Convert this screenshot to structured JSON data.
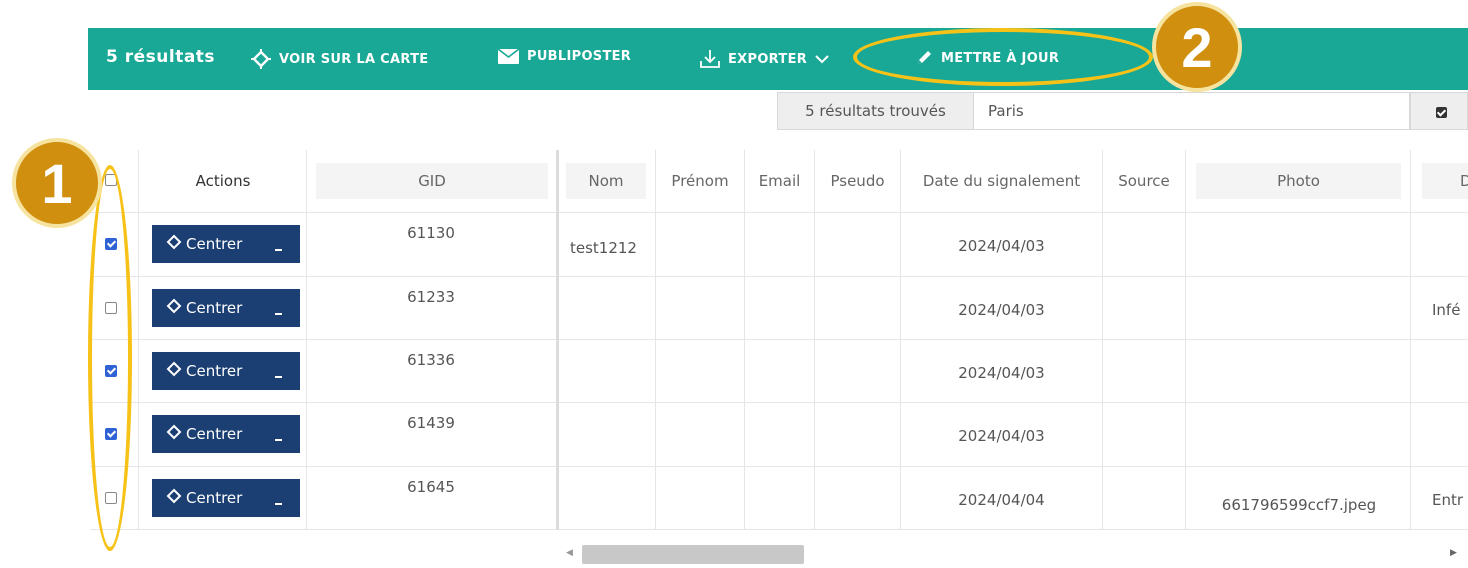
{
  "toolbar": {
    "results_count": "5 résultats",
    "view_map_label": "VOIR SUR LA CARTE",
    "mail_merge_label": "PUBLIPOSTER",
    "export_label": "EXPORTER",
    "update_label": "METTRE À JOUR",
    "background_color": "#19a896"
  },
  "search": {
    "found_label": "5 résultats trouvés",
    "value": "Paris"
  },
  "table": {
    "headers": {
      "actions": "Actions",
      "gid": "GID",
      "nom": "Nom",
      "prenom": "Prénom",
      "email": "Email",
      "pseudo": "Pseudo",
      "date": "Date du signalement",
      "source": "Source",
      "photo": "Photo",
      "next": "D"
    },
    "button_label": "Centrer",
    "rows": [
      {
        "checked": true,
        "gid": "61130",
        "nom": "test1212",
        "date": "2024/04/03",
        "photo": "",
        "next": ""
      },
      {
        "checked": false,
        "gid": "61233",
        "nom": "",
        "date": "2024/04/03",
        "photo": "",
        "next": "Infé"
      },
      {
        "checked": true,
        "gid": "61336",
        "nom": "",
        "date": "2024/04/03",
        "photo": "",
        "next": ""
      },
      {
        "checked": true,
        "gid": "61439",
        "nom": "",
        "date": "2024/04/03",
        "photo": "",
        "next": ""
      },
      {
        "checked": false,
        "gid": "61645",
        "nom": "",
        "date": "2024/04/04",
        "photo": "661796599ccf7.jpeg",
        "next": "Entr"
      }
    ]
  },
  "annotations": {
    "marker_1": "1",
    "marker_2": "2",
    "accent_color": "#f7c218",
    "marker_color": "#d08f0e"
  }
}
